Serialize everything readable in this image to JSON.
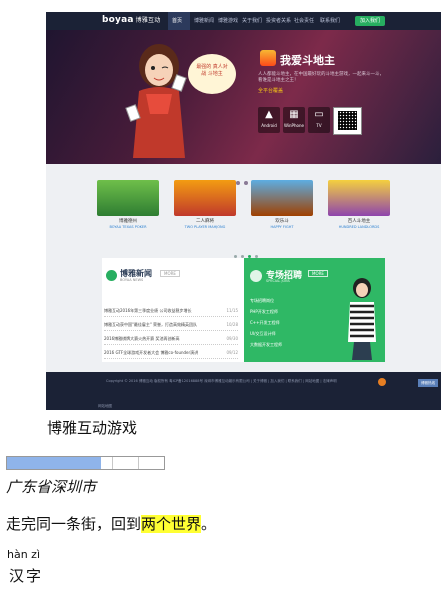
{
  "site": {
    "logo_text": "boyaa",
    "logo_cn": "博雅互动",
    "nav": [
      "首页",
      "博雅新闻",
      "博雅游戏",
      "关于我们",
      "投资者关系",
      "社会责任",
      "联系我们"
    ],
    "join_label": "加入我们",
    "hero": {
      "title": "我爱斗地主",
      "subtitle": "人人都能斗地主，在中国最好玩的斗地主游戏，一起来斗一斗，看谁是斗地主之王！",
      "tag": "全平台覆盖",
      "platforms": [
        "Android",
        "WinPhone",
        "TV"
      ],
      "bubble": "最强的 真人对战 斗地主",
      "slide_count": 5,
      "active_slide": 4
    },
    "games": [
      {
        "name": "博雅德州",
        "en": "BOYAA TEXAS POKER"
      },
      {
        "name": "二人麻将",
        "en": "TWO PLAYER MAHJONG"
      },
      {
        "name": "欢乐斗",
        "en": "HAPPY FIGHT"
      },
      {
        "name": "百人斗地主",
        "en": "HUNDRED LANDLORDS"
      }
    ],
    "news": {
      "title": "博雅新闻",
      "en": "BOYAA NEWS",
      "more": "MORE",
      "items": [
        {
          "text": "博雅互动2016年第三季度业绩 公司收益稳步增长",
          "date": "11/15"
        },
        {
          "text": "博雅互动获中国\"最佳雇主\" 荣誉，打造高效精英团队",
          "date": "10/28"
        },
        {
          "text": "2016博雅棋牌大赛火热开赛 奖池再创新高",
          "date": "09/30"
        },
        {
          "text": "2016 GTF全球游戏开发者大会 博雅co-founder演讲",
          "date": "09/12"
        }
      ]
    },
    "jobs": {
      "title": "专场招聘",
      "en": "SPECIAL JOBS",
      "more": "MORE",
      "items": [
        "专场招聘岗位",
        "PHP开发工程师",
        "C++开发工程师",
        "UI/交互设计师",
        "大数据开发工程师"
      ]
    },
    "footer": {
      "text": "Copyright © 2016 博雅互动 版权所有 粤ICP备12016888号 深圳市博雅互动娱乐有限公司 | 关于博雅 | 加入我们 | 联系我们 | 网站地图 | 法律声明",
      "button": "博雅热线",
      "link": "网站地图"
    }
  },
  "caption": "博雅互动游戏",
  "progress": {
    "percent": 60,
    "segments": 6
  },
  "location": "广东省深圳市",
  "sentence": {
    "before": "走完同一条街，回到",
    "highlight": "两个世界",
    "after": "。"
  },
  "pinyin": "hàn zì",
  "hanzi": "汉字",
  "colors": {
    "highlight": "#ffff33",
    "progress": "#8fb4ea",
    "brand_green": "#27ae60",
    "nav_bg": "#1b2236"
  }
}
